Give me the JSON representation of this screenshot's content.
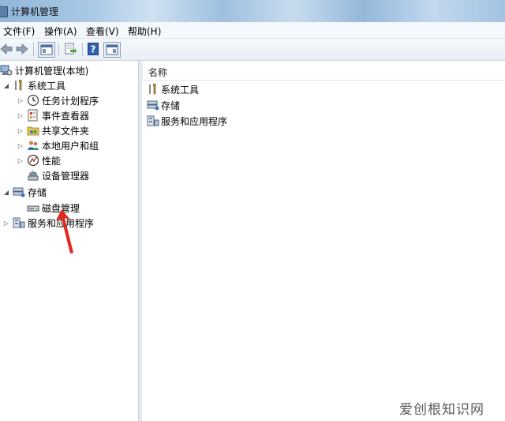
{
  "window": {
    "title": "计算机管理"
  },
  "menu": [
    {
      "label": "文件(F)"
    },
    {
      "label": "操作(A)"
    },
    {
      "label": "查看(V)"
    },
    {
      "label": "帮助(H)"
    }
  ],
  "tree": {
    "root": "计算机管理(本地)",
    "system_tools": "系统工具",
    "task_scheduler": "任务计划程序",
    "event_viewer": "事件查看器",
    "shared_folders": "共享文件夹",
    "local_users": "本地用户和组",
    "performance": "性能",
    "device_manager": "设备管理器",
    "storage": "存储",
    "disk_management": "磁盘管理",
    "services_apps": "服务和应用程序"
  },
  "list": {
    "column_name": "名称",
    "items": [
      "系统工具",
      "存储",
      "服务和应用程序"
    ]
  },
  "watermark": "爱创根知识网"
}
